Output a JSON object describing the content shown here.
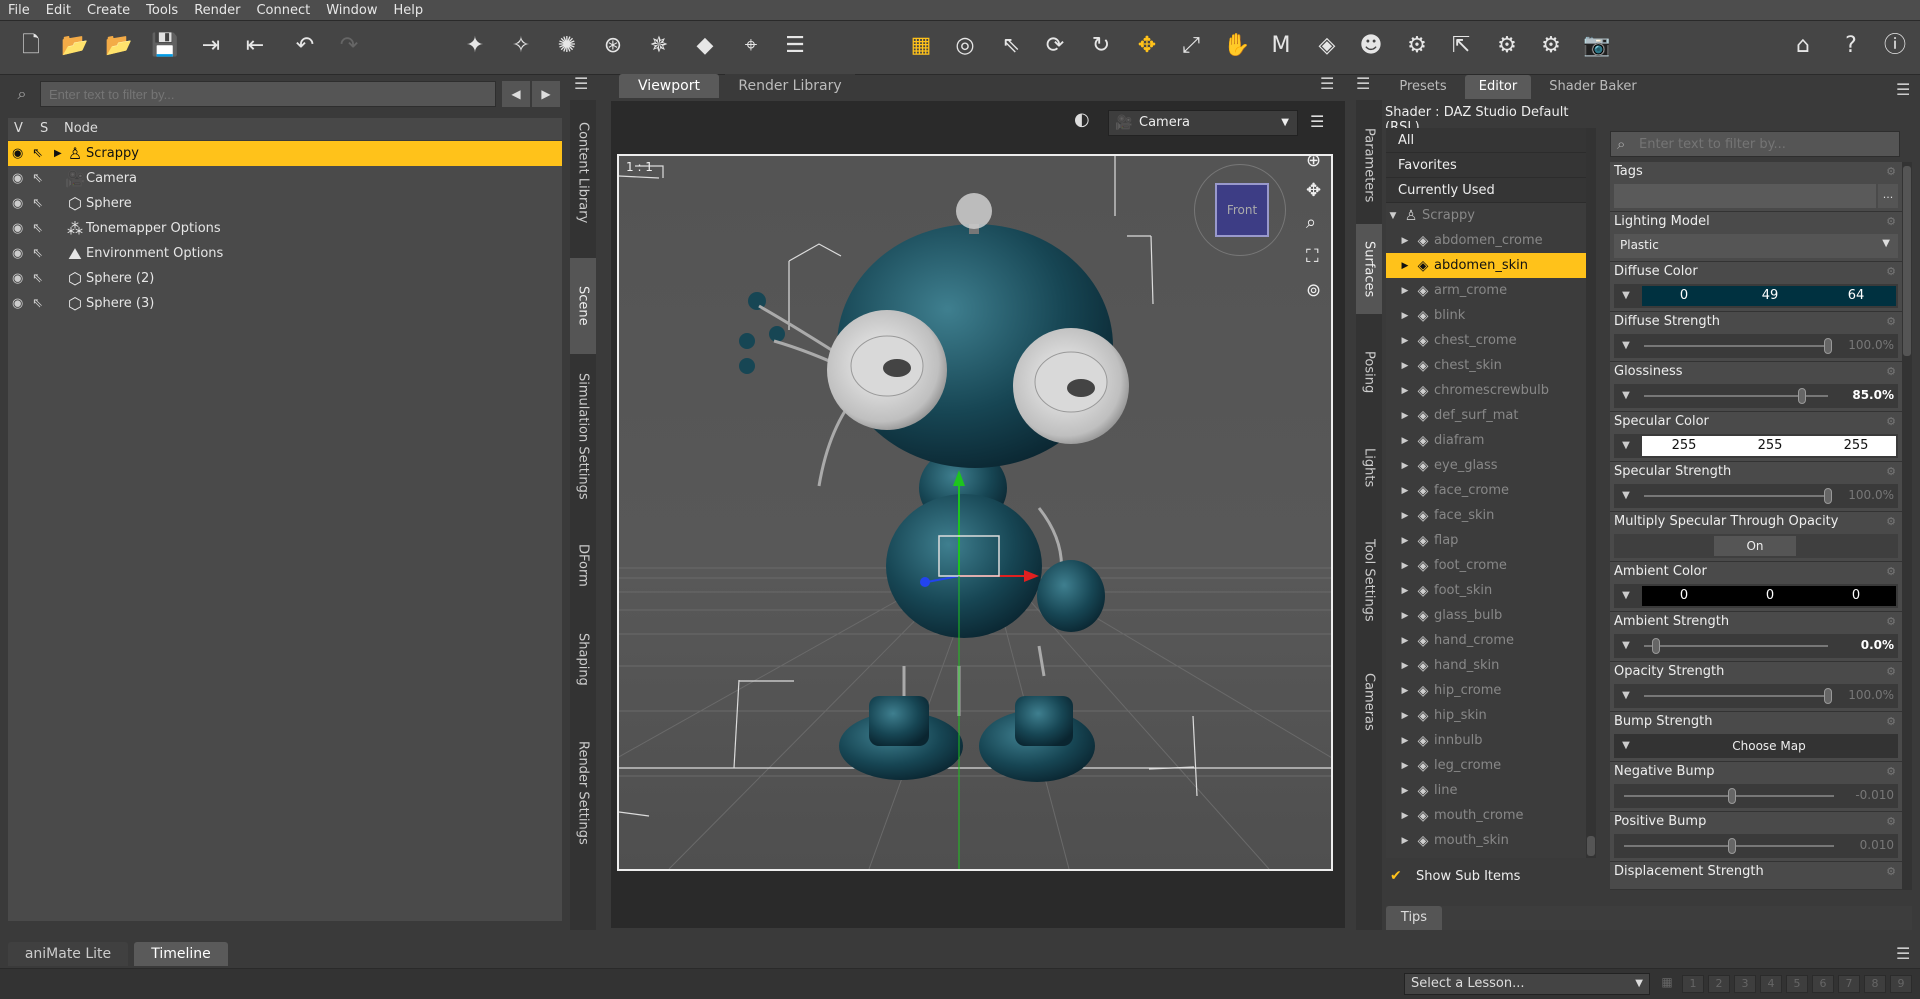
{
  "menu": [
    "File",
    "Edit",
    "Create",
    "Tools",
    "Render",
    "Connect",
    "Window",
    "Help"
  ],
  "left": {
    "filter_placeholder": "Enter text to filter by...",
    "cols": {
      "v": "V",
      "s": "S",
      "node": "Node"
    },
    "nodes": [
      {
        "label": "Scrappy",
        "selected": true,
        "icon": "figure-icon"
      },
      {
        "label": "Camera",
        "icon": "camera-icon"
      },
      {
        "label": "Sphere",
        "icon": "sphere-icon"
      },
      {
        "label": "Tonemapper Options",
        "icon": "tonemapper-icon"
      },
      {
        "label": "Environment Options",
        "icon": "environment-icon"
      },
      {
        "label": "Sphere (2)",
        "icon": "sphere-icon"
      },
      {
        "label": "Sphere (3)",
        "icon": "sphere-icon"
      }
    ],
    "side_tabs": [
      "Content Library",
      "Scene",
      "Simulation Settings",
      "DForm",
      "Shaping",
      "Render Settings"
    ]
  },
  "center": {
    "tabs": [
      "Viewport",
      "Render Library"
    ],
    "camera": "Camera",
    "ratio": "1 : 1",
    "cube_label": "Front"
  },
  "right": {
    "side_tabs": [
      "Parameters",
      "Surfaces",
      "Posing",
      "Lights",
      "Tool Settings",
      "Cameras"
    ],
    "tabs": [
      "Presets",
      "Editor",
      "Shader Baker"
    ],
    "shader": "Shader : DAZ Studio Default (RSL)",
    "categories": [
      "All",
      "Favorites",
      "Currently Used"
    ],
    "figure": "Scrappy",
    "surfaces": [
      "abdomen_crome",
      "abdomen_skin",
      "arm_crome",
      "blink",
      "chest_crome",
      "chest_skin",
      "chromescrewbulb",
      "def_surf_mat",
      "diafram",
      "eye_glass",
      "face_crome",
      "face_skin",
      "flap",
      "foot_crome",
      "foot_skin",
      "glass_bulb",
      "hand_crome",
      "hand_skin",
      "hip_crome",
      "hip_skin",
      "innbulb",
      "leg_crome",
      "line",
      "mouth_crome",
      "mouth_skin"
    ],
    "selected_surface": "abdomen_skin",
    "show_sub": "Show Sub Items",
    "filter_placeholder": "Enter text to filter by...",
    "props": {
      "tags": "Tags",
      "lighting_model": {
        "label": "Lighting Model",
        "value": "Plastic"
      },
      "diffuse_color": {
        "label": "Diffuse Color",
        "r": "0",
        "g": "49",
        "b": "64"
      },
      "diffuse_strength": {
        "label": "Diffuse Strength",
        "value": "100.0%"
      },
      "glossiness": {
        "label": "Glossiness",
        "value": "85.0%"
      },
      "specular_color": {
        "label": "Specular Color",
        "r": "255",
        "g": "255",
        "b": "255"
      },
      "specular_strength": {
        "label": "Specular Strength",
        "value": "100.0%"
      },
      "mult_spec": {
        "label": "Multiply Specular Through Opacity",
        "value": "On"
      },
      "ambient_color": {
        "label": "Ambient Color",
        "r": "0",
        "g": "0",
        "b": "0"
      },
      "ambient_strength": {
        "label": "Ambient Strength",
        "value": "0.0%"
      },
      "opacity_strength": {
        "label": "Opacity Strength",
        "value": "100.0%"
      },
      "bump_strength": {
        "label": "Bump Strength",
        "value": "Choose Map"
      },
      "negative_bump": {
        "label": "Negative Bump",
        "value": "-0.010"
      },
      "positive_bump": {
        "label": "Positive Bump",
        "value": "0.010"
      },
      "displacement": {
        "label": "Displacement Strength"
      }
    },
    "tips": "Tips"
  },
  "bottom": {
    "tabs": [
      "aniMate Lite",
      "Timeline"
    ],
    "lesson": "Select a Lesson...",
    "lesson_nums": [
      "1",
      "2",
      "3",
      "4",
      "5",
      "6",
      "7",
      "8",
      "9"
    ]
  }
}
